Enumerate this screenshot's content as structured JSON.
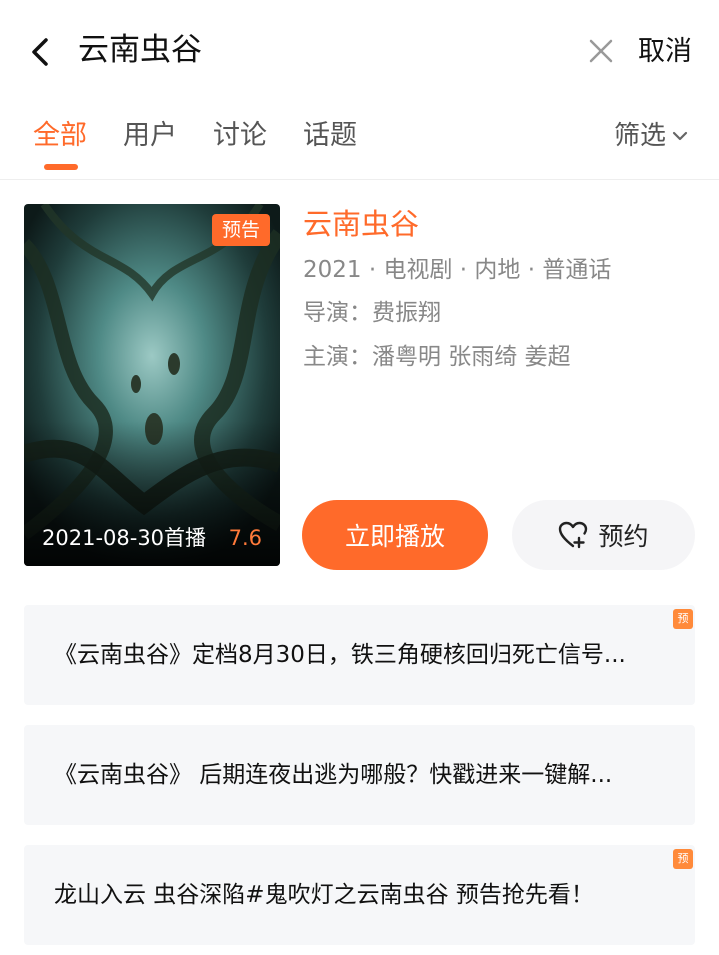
{
  "search": {
    "query": "云南虫谷",
    "cancel_label": "取消"
  },
  "tabs": [
    {
      "label": "全部",
      "active": true
    },
    {
      "label": "用户",
      "active": false
    },
    {
      "label": "讨论",
      "active": false
    },
    {
      "label": "话题",
      "active": false
    }
  ],
  "filter": {
    "label": "筛选"
  },
  "result": {
    "title": "云南虫谷",
    "info": "2021 · 电视剧 · 内地 · 普通话",
    "director": "导演：费振翔",
    "cast": "主演：潘粤明 张雨绮 姜超",
    "poster": {
      "badge": "预告",
      "premiere": "2021-08-30首播",
      "score": "7.6"
    },
    "play_label": "立即播放",
    "reserve_label": "预约"
  },
  "related": [
    {
      "text": "《云南虫谷》定档8月30日，铁三角硬核回归死亡信号...",
      "badge": "预"
    },
    {
      "text": "《云南虫谷》 后期连夜出逃为哪般？快戳进来一键解...",
      "badge": ""
    },
    {
      "text": "龙山入云 虫谷深陷#鬼吹灯之云南虫谷 预告抢先看！",
      "badge": "预"
    }
  ],
  "colors": {
    "accent": "#ff6a2a",
    "muted_text": "#888888",
    "card_bg": "#f6f7f9"
  }
}
